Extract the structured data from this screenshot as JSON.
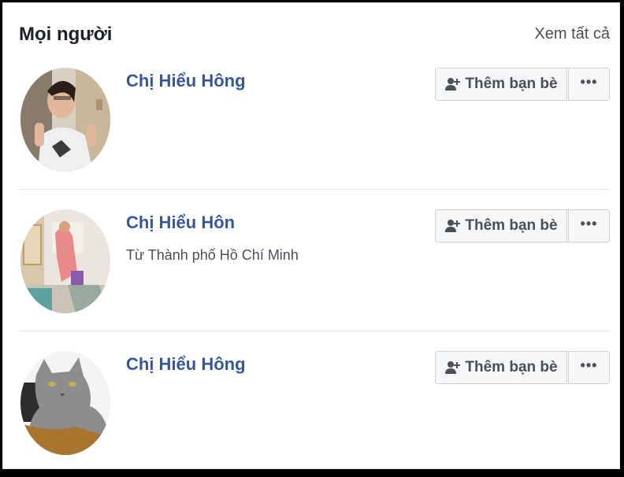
{
  "section": {
    "title": "Mọi người",
    "see_all": "Xem tất cả"
  },
  "people": [
    {
      "name": "Chị Hiểu Hông",
      "subtitle": "",
      "add_friend_label": "Thêm bạn bè",
      "more_label": "•••"
    },
    {
      "name": "Chị Hiểu Hôn",
      "subtitle": "Từ Thành phố Hồ Chí Minh",
      "add_friend_label": "Thêm bạn bè",
      "more_label": "•••"
    },
    {
      "name": "Chị Hiểu Hông",
      "subtitle": "",
      "add_friend_label": "Thêm bạn bè",
      "more_label": "•••"
    }
  ],
  "colors": {
    "name_link": "#365899",
    "button_bg": "#f6f7f9",
    "button_border": "#ced0d4",
    "text_secondary": "#4b4f56"
  },
  "icons": {
    "add_friend": "add-friend-icon",
    "more": "more-options-icon"
  }
}
